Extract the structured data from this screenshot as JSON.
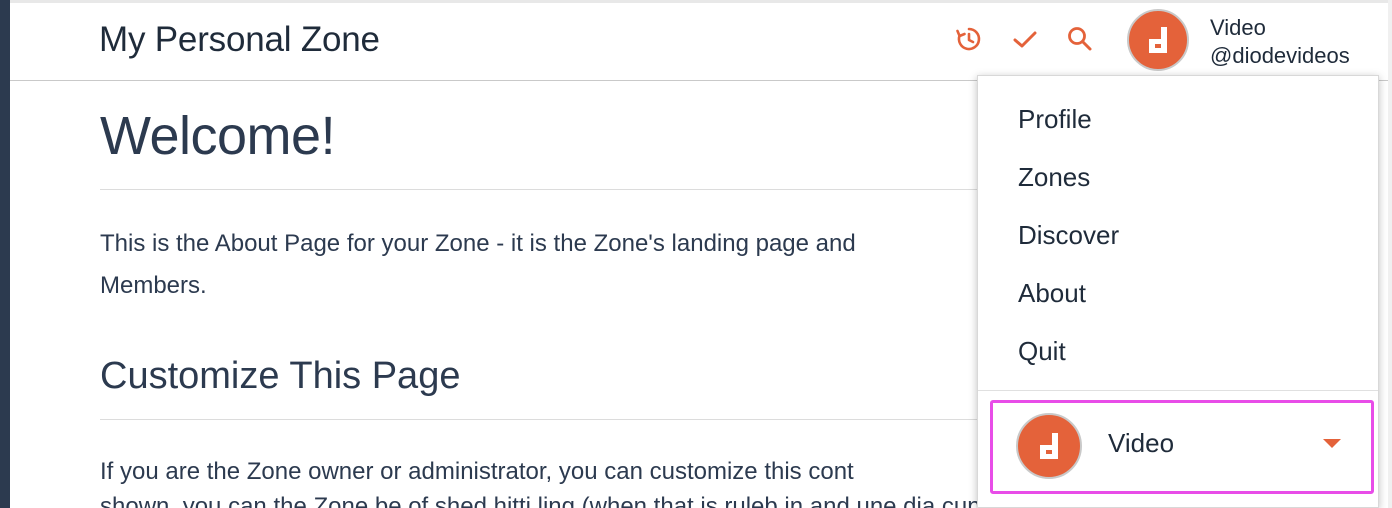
{
  "header": {
    "title": "My Personal Zone",
    "user_name": "Video",
    "user_handle": "@diodevideos",
    "icons": [
      "history-icon",
      "check-icon",
      "search-icon"
    ]
  },
  "content": {
    "heading": "Welcome!",
    "paragraph1": "This is the About Page for your Zone - it is the Zone's landing page and",
    "paragraph1_line2": "Members.",
    "subheading": "Customize This Page",
    "paragraph2": "If you are the Zone owner or administrator, you can customize this cont",
    "paragraph2_line2": "shown, you can the Zone be of shed hitti ling (when that is ruleb in and une dia cunnen)"
  },
  "menu": {
    "items": [
      {
        "label": "Profile"
      },
      {
        "label": "Zones"
      },
      {
        "label": "Discover"
      },
      {
        "label": "About"
      },
      {
        "label": "Quit"
      }
    ],
    "zone_selector": {
      "label": "Video"
    }
  },
  "colors": {
    "accent": "#e4623a",
    "text": "#2c3a4f",
    "highlight": "#e84de8"
  }
}
